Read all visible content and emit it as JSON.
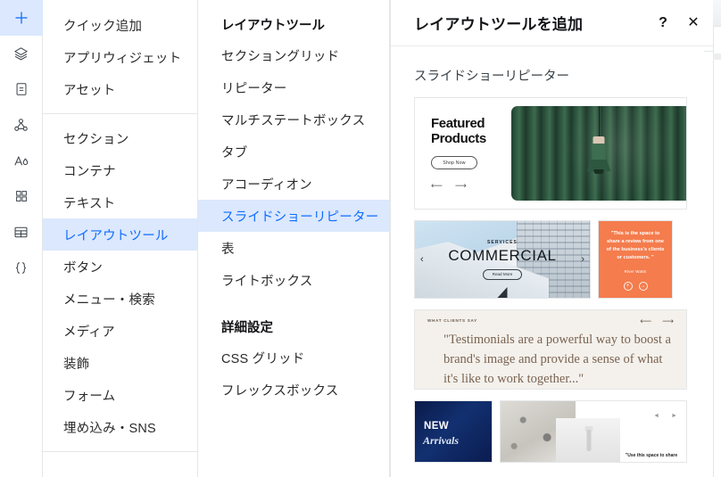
{
  "rail": {
    "items": [
      {
        "name": "add-icon",
        "glyph": "plus",
        "active": true
      },
      {
        "name": "layers-icon",
        "glyph": "layers",
        "active": false
      },
      {
        "name": "pages-icon",
        "glyph": "page",
        "active": false
      },
      {
        "name": "sitemap-icon",
        "glyph": "nodes",
        "active": false
      },
      {
        "name": "text-theme-icon",
        "glyph": "text",
        "active": false
      },
      {
        "name": "apps-icon",
        "glyph": "grid",
        "active": false
      },
      {
        "name": "table-icon",
        "glyph": "table",
        "active": false
      },
      {
        "name": "dev-mode-icon",
        "glyph": "braces",
        "active": false
      }
    ]
  },
  "column1": {
    "group1": [
      "クイック追加",
      "アプリウィジェット",
      "アセット"
    ],
    "group2": [
      "セクション",
      "コンテナ",
      "テキスト",
      "レイアウトツール",
      "ボタン",
      "メニュー・検索",
      "メディア",
      "装飾",
      "フォーム",
      "埋め込み・SNS"
    ],
    "selected": "レイアウトツール"
  },
  "column2": {
    "heading1": "レイアウトツール",
    "group1": [
      "セクショングリッド",
      "リピーター",
      "マルチステートボックス",
      "タブ",
      "アコーディオン",
      "スライドショーリピーター",
      "表",
      "ライトボックス"
    ],
    "selected": "スライドショーリピーター",
    "heading2": "詳細設定",
    "group2": [
      "CSS グリッド",
      "フレックスボックス"
    ]
  },
  "panel": {
    "title": "レイアウトツールを追加",
    "help_label": "?",
    "close_label": "✕",
    "category_label": "スライドショーリピーター",
    "cards": {
      "featured": {
        "heading_line1": "Featured",
        "heading_line2": "Products",
        "button": "Shop Now",
        "prev": "⟵",
        "next": "⟶"
      },
      "commercial": {
        "kicker": "SERVICES",
        "title": "COMMERCIAL",
        "button": "Read More",
        "prev": "‹",
        "next": "›"
      },
      "review": {
        "quote": "\"This is the space to share a review from one of the business's clients or customers. \"",
        "author": "River Watts",
        "dot1": "+",
        "dot2": "→"
      },
      "clients": {
        "kicker": "WHAT CLIENTS SAY",
        "quote": "\"Testimonials are a powerful way to boost a brand's image and provide a sense of what it's like to work together...\"",
        "prev": "⟵",
        "next": "⟶"
      },
      "new_arrivals": {
        "line1": "NEW",
        "line2": "Arrivals"
      },
      "gallery": {
        "caption": "\"Use this space to share",
        "prev": "◄",
        "next": "►"
      }
    }
  },
  "colors": {
    "accent": "#116dff",
    "accent_bg": "#dbe8fd",
    "border": "#e4e6e8",
    "orange_card": "#f47c4d",
    "green_image": "#2f5840",
    "navy_card": "#0a1a4a",
    "beige_card": "#f4f1ec"
  }
}
